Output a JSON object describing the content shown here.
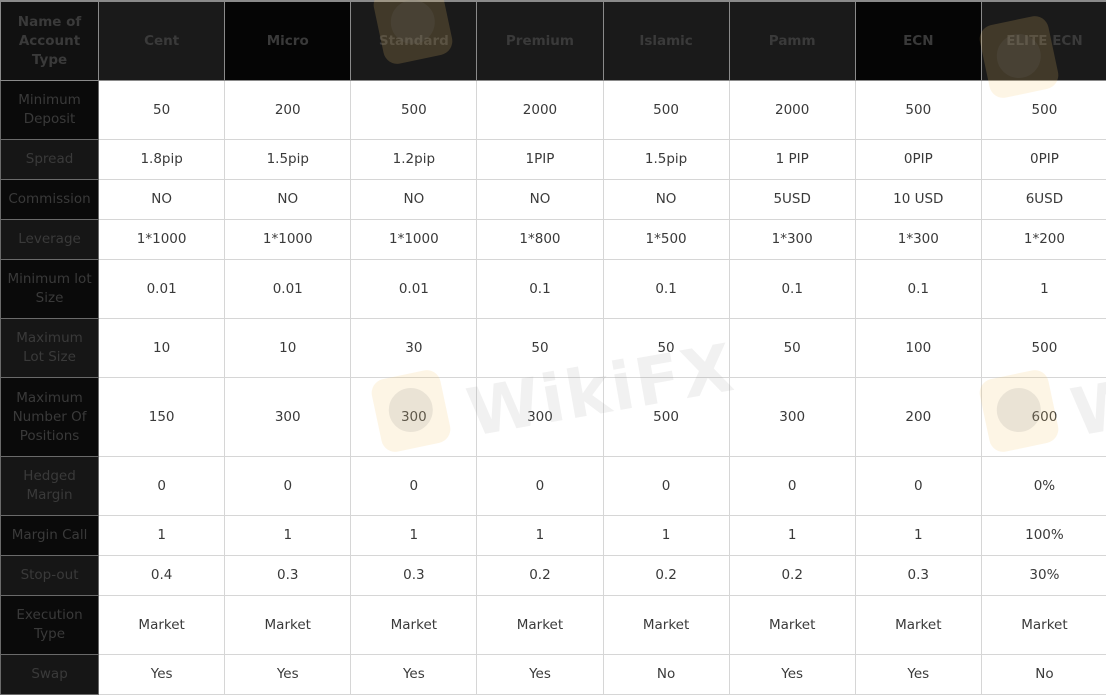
{
  "table": {
    "corner_label": "Name of Account Type",
    "columns": [
      "Cent",
      "Micro",
      "Standard",
      "Premium",
      "Islamic",
      "Pamm",
      "ECN",
      "ELITE ECN"
    ],
    "rows": [
      {
        "label": "Minimum Deposit",
        "values": [
          "50",
          "200",
          "500",
          "2000",
          "500",
          "2000",
          "500",
          "500"
        ]
      },
      {
        "label": "Spread",
        "values": [
          "1.8pip",
          "1.5pip",
          "1.2pip",
          "1PIP",
          "1.5pip",
          "1 PIP",
          "0PIP",
          "0PIP"
        ]
      },
      {
        "label": "Commission",
        "values": [
          "NO",
          "NO",
          "NO",
          "NO",
          "NO",
          "5USD",
          "10 USD",
          "6USD"
        ]
      },
      {
        "label": "Leverage",
        "values": [
          "1*1000",
          "1*1000",
          "1*1000",
          "1*800",
          "1*500",
          "1*300",
          "1*300",
          "1*200"
        ]
      },
      {
        "label": "Minimum lot Size",
        "values": [
          "0.01",
          "0.01",
          "0.01",
          "0.1",
          "0.1",
          "0.1",
          "0.1",
          "1"
        ]
      },
      {
        "label": "Maximum Lot Size",
        "values": [
          "10",
          "10",
          "30",
          "50",
          "50",
          "50",
          "100",
          "500"
        ]
      },
      {
        "label": "Maximum Number Of Positions",
        "values": [
          "150",
          "300",
          "300",
          "300",
          "500",
          "300",
          "200",
          "600"
        ]
      },
      {
        "label": "Hedged Margin",
        "values": [
          "0",
          "0",
          "0",
          "0",
          "0",
          "0",
          "0",
          "0%"
        ]
      },
      {
        "label": "Margin Call",
        "values": [
          "1",
          "1",
          "1",
          "1",
          "1",
          "1",
          "1",
          "100%"
        ]
      },
      {
        "label": "Stop-out",
        "values": [
          "0.4",
          "0.3",
          "0.3",
          "0.2",
          "0.2",
          "0.2",
          "0.3",
          "30%"
        ]
      },
      {
        "label": "Execution Type",
        "values": [
          "Market",
          "Market",
          "Market",
          "Market",
          "Market",
          "Market",
          "Market",
          "Market"
        ]
      },
      {
        "label": "Swap",
        "values": [
          "Yes",
          "Yes",
          "Yes",
          "Yes",
          "No",
          "Yes",
          "Yes",
          "No"
        ]
      }
    ]
  },
  "watermark": {
    "text": "WikiFX"
  },
  "colors": {
    "header_bg": "#1a1a1a",
    "header_text": "#e8b52a",
    "row_label_bg": "#0a0a0a",
    "row_label_text": "#e2b84a",
    "cell_text": "#3a3a3a",
    "grid": "#d6d6d6"
  }
}
